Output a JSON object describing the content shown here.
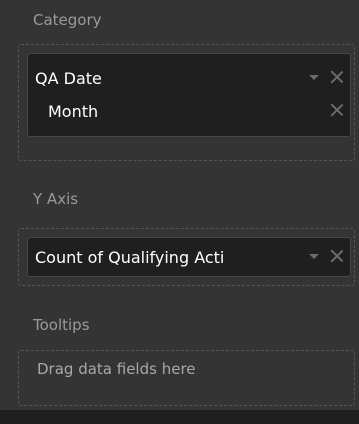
{
  "category": {
    "label": "Category",
    "fields": [
      {
        "name": "QA Date",
        "has_dropdown": true
      },
      {
        "name": "Month",
        "has_dropdown": false
      }
    ]
  },
  "y_axis": {
    "label": "Y Axis",
    "fields": [
      {
        "name": "Count of Qualifying Acti",
        "has_dropdown": true
      }
    ]
  },
  "tooltips": {
    "label": "Tooltips",
    "placeholder": "Drag data fields here"
  },
  "colors": {
    "panel_bg": "#343434",
    "field_bg": "#1f1f1f",
    "label_gray": "#9a9a9a",
    "icon_gray": "#6b6b6b"
  }
}
